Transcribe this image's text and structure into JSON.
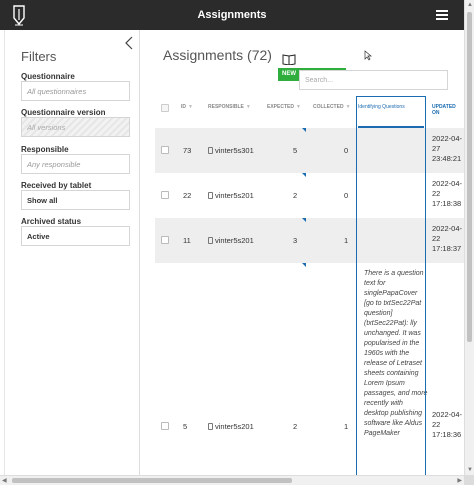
{
  "header": {
    "title": "Assignments",
    "menu_icon": "hamburger-icon",
    "logo_icon": "pen-logo-icon"
  },
  "sidebar": {
    "title": "Filters",
    "collapse_icon": "chevron-left-icon",
    "filters": [
      {
        "label": "Questionnaire",
        "value": "All questionnaires",
        "kind": "placeholder"
      },
      {
        "label": "Questionnaire version",
        "value": "All versions",
        "kind": "disabled"
      },
      {
        "label": "Responsible",
        "value": "Any responsible",
        "kind": "placeholder"
      },
      {
        "label": "Received by tablet",
        "value": "Show all",
        "kind": "value"
      },
      {
        "label": "Archived status",
        "value": "Active",
        "kind": "value"
      }
    ]
  },
  "main": {
    "title": "Assignments (72)",
    "new_label": "NEW",
    "search_placeholder": "Search...",
    "columns": [
      "ID",
      "RESPONSIBLE",
      "EXPECTED",
      "COLLECTED",
      "Identifying Questions",
      "UPDATED ON"
    ],
    "rows": [
      {
        "id": "73",
        "responsible": "vinter5s301",
        "expected": "5",
        "collected": "0",
        "updated": [
          "2022-04-",
          "27",
          "23:48:21"
        ],
        "identifying": ""
      },
      {
        "id": "22",
        "responsible": "vinter5s201",
        "expected": "2",
        "collected": "0",
        "updated": [
          "2022-04-",
          "22",
          "17:18:38"
        ],
        "identifying": ""
      },
      {
        "id": "11",
        "responsible": "vinter5s201",
        "expected": "3",
        "collected": "1",
        "updated": [
          "2022-04-",
          "22",
          "17:18:37"
        ],
        "identifying": ""
      },
      {
        "id": "5",
        "responsible": "vinter5s201",
        "expected": "2",
        "collected": "1",
        "updated": [
          "2022-04-",
          "22",
          "17:18:36"
        ],
        "identifying": "There is a question text for singlePapaCover [go to txtSec22Pat question] (txtSec22Pat): lly unchanged. It was popularised in the 1960s with the release of Letraset sheets containing Lorem Ipsum passages, and more recently with desktop publishing software like Aldus PageMaker"
      }
    ]
  },
  "colors": {
    "accent": "#1b6bb0",
    "new_button": "#2fae3e",
    "topbar": "#2b2b2b"
  }
}
